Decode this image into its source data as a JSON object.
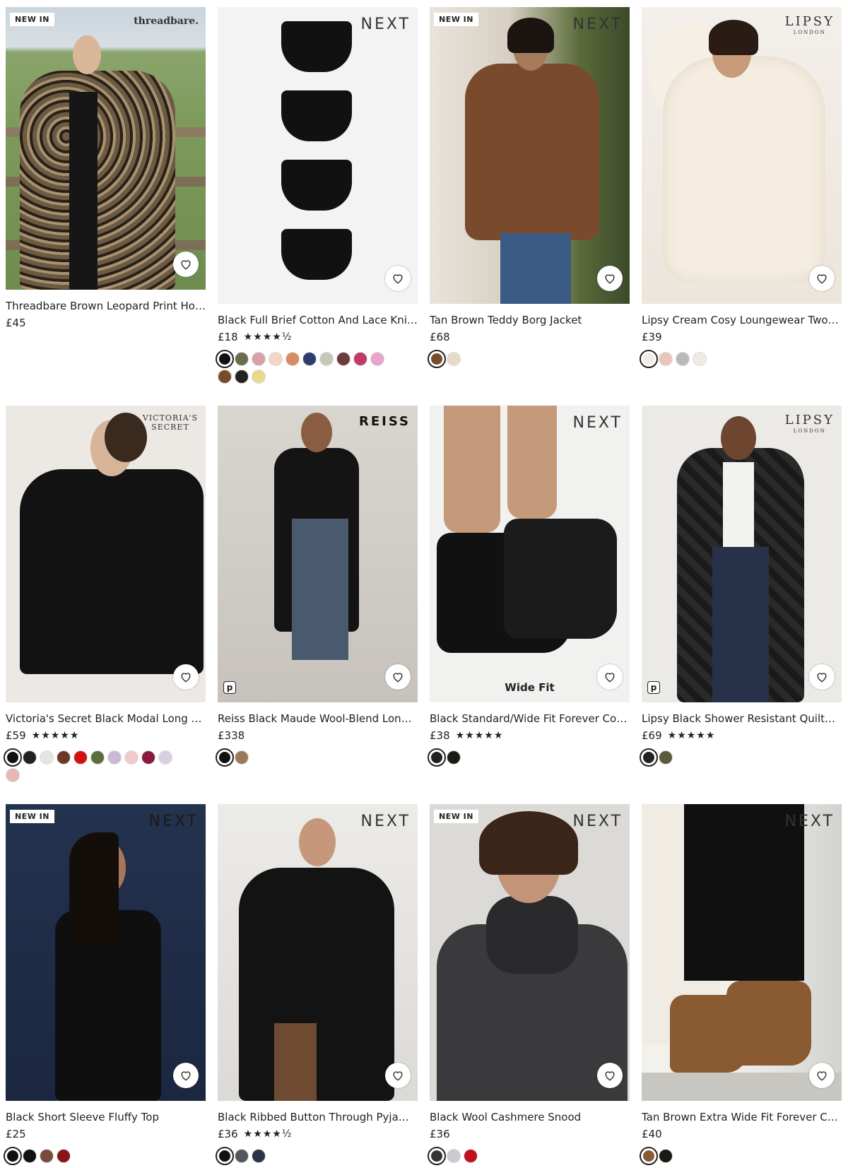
{
  "products": [
    {
      "badge": "NEW IN",
      "brand": "threadbare.",
      "title": "Threadbare Brown Leopard Print Ho…",
      "price": "£45",
      "rating": "",
      "swatches": []
    },
    {
      "badge": "",
      "brand": "NEXT",
      "title": "Black Full Brief Cotton And Lace Kni…",
      "price": "£18",
      "rating": "★★★★½",
      "swatches": [
        "#111111",
        "#6b6b4e",
        "#d9a0a8",
        "#f2d5c4",
        "#d88b61",
        "#2d3b6e",
        "#c7c7b7",
        "#6e3b3b",
        "#c23a6a",
        "#e7a5c9",
        "#7b4a2c",
        "#222222",
        "#e9d98a"
      ]
    },
    {
      "badge": "NEW IN",
      "brand": "NEXT",
      "title": "Tan Brown Teddy Borg Jacket",
      "price": "£68",
      "rating": "",
      "swatches": [
        "#7a4a2c",
        "#e4dcc8"
      ]
    },
    {
      "badge": "",
      "brand": "LIPSY",
      "brand_sub": "LONDON",
      "title": "Lipsy Cream Cosy Loungewear Two…",
      "price": "£39",
      "rating": "",
      "swatches": [
        "#f1ece3",
        "#e8c4bd",
        "#b9b9b9",
        "#efebe2"
      ]
    },
    {
      "badge": "",
      "brand": "VICTORIA'S SECRET",
      "title": "Victoria's Secret Black Modal Long …",
      "price": "£59",
      "rating": "★★★★★",
      "swatches": [
        "#111111",
        "#222222",
        "#e6e6e0",
        "#6b3a24",
        "#d41010",
        "#5a6d3a",
        "#c9b8d6",
        "#f2c9c9",
        "#8a1840",
        "#d9cfe0",
        "#e6b8b3"
      ]
    },
    {
      "badge": "",
      "brand": "REISS",
      "title": "Reiss Black Maude Wool-Blend Lon…",
      "price": "£338",
      "rating": "",
      "swatches": [
        "#111111",
        "#9a7a5a"
      ]
    },
    {
      "badge": "",
      "brand": "NEXT",
      "title": "Black Standard/Wide Fit Forever Co…",
      "price": "£38",
      "rating": "★★★★★",
      "swatches": [
        "#222222",
        "#1c1a14"
      ],
      "overlay": "Wide Fit"
    },
    {
      "badge": "",
      "brand": "LIPSY",
      "brand_sub": "LONDON",
      "title": "Lipsy Black Shower Resistant Quilte…",
      "price": "£69",
      "rating": "★★★★★",
      "swatches": [
        "#222222",
        "#5c5a3a"
      ]
    },
    {
      "badge": "NEW IN",
      "brand": "NEXT",
      "title": "Black Short Sleeve Fluffy Top",
      "price": "£25",
      "rating": "",
      "swatches": [
        "#111111",
        "#111111",
        "#7a4a3a",
        "#8a1418"
      ]
    },
    {
      "badge": "",
      "brand": "NEXT",
      "title": "Black Ribbed Button Through Pyja…",
      "price": "£36",
      "rating": "★★★★½",
      "swatches": [
        "#111111",
        "#555560",
        "#2a3348"
      ]
    },
    {
      "badge": "NEW IN",
      "brand": "NEXT",
      "title": "Black Wool Cashmere Snood",
      "price": "£36",
      "rating": "",
      "swatches": [
        "#333333",
        "#c9c9d0",
        "#c0111e"
      ]
    },
    {
      "badge": "",
      "brand": "NEXT",
      "title": "Tan Brown Extra Wide Fit Forever Co…",
      "price": "£40",
      "rating": "",
      "swatches": [
        "#8a5a32",
        "#1a1a14"
      ]
    }
  ]
}
